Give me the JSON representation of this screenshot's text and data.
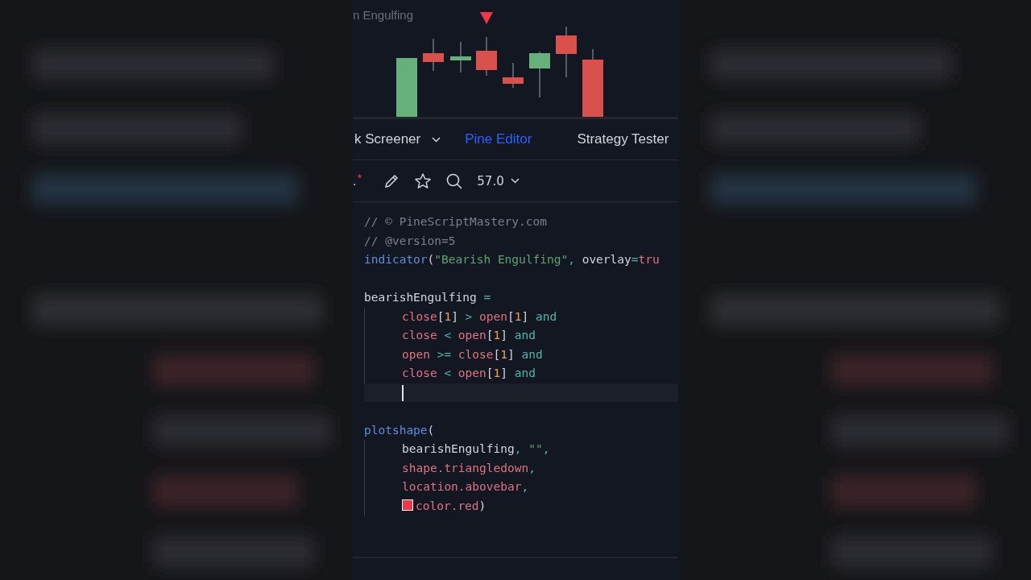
{
  "chart": {
    "title": "n Engulfing"
  },
  "tabs": [
    {
      "label": "k Screener",
      "selected": false,
      "dropdown": true
    },
    {
      "label": "Pine Editor",
      "selected": true,
      "dropdown": false
    },
    {
      "label": "Strategy Tester",
      "selected": false,
      "dropdown": false
    }
  ],
  "toolbar": {
    "script_name": ".",
    "unsaved_mark": "*",
    "version": "57.0"
  },
  "code": [
    {
      "kind": "code",
      "tokens": [
        {
          "kind": "comment",
          "text": "// © PineScriptMastery.com"
        }
      ]
    },
    {
      "kind": "code",
      "tokens": [
        {
          "kind": "comment",
          "text": "// @version=5"
        }
      ]
    },
    {
      "kind": "code",
      "tokens": [
        {
          "kind": "func",
          "text": "indicator"
        },
        {
          "kind": "plain",
          "text": "("
        },
        {
          "kind": "string",
          "text": "\"Bearish Engulfing\""
        },
        {
          "kind": "keyword",
          "text": ","
        },
        {
          "kind": "plain",
          "text": " overlay"
        },
        {
          "kind": "keyword",
          "text": "="
        },
        {
          "kind": "var",
          "text": "tru"
        }
      ]
    },
    {
      "kind": "blank"
    },
    {
      "kind": "code",
      "tokens": [
        {
          "kind": "plain",
          "text": "bearishEngulfing"
        },
        {
          "kind": "keyword",
          "text": " ="
        }
      ],
      "children": [
        {
          "kind": "code",
          "tokens": [
            {
              "kind": "var",
              "text": "close"
            },
            {
              "kind": "plain",
              "text": "["
            },
            {
              "kind": "number",
              "text": "1"
            },
            {
              "kind": "plain",
              "text": "]"
            },
            {
              "kind": "keyword",
              "text": " > "
            },
            {
              "kind": "var",
              "text": "open"
            },
            {
              "kind": "plain",
              "text": "["
            },
            {
              "kind": "number",
              "text": "1"
            },
            {
              "kind": "plain",
              "text": "]"
            },
            {
              "kind": "keyword",
              "text": " and"
            }
          ]
        },
        {
          "kind": "code",
          "tokens": [
            {
              "kind": "var",
              "text": "close"
            },
            {
              "kind": "keyword",
              "text": " < "
            },
            {
              "kind": "var",
              "text": "open"
            },
            {
              "kind": "plain",
              "text": "["
            },
            {
              "kind": "number",
              "text": "1"
            },
            {
              "kind": "plain",
              "text": "]"
            },
            {
              "kind": "keyword",
              "text": " and"
            }
          ]
        },
        {
          "kind": "code",
          "tokens": [
            {
              "kind": "var",
              "text": "open"
            },
            {
              "kind": "keyword",
              "text": " >= "
            },
            {
              "kind": "var",
              "text": "close"
            },
            {
              "kind": "plain",
              "text": "["
            },
            {
              "kind": "number",
              "text": "1"
            },
            {
              "kind": "plain",
              "text": "]"
            },
            {
              "kind": "keyword",
              "text": " and"
            }
          ]
        },
        {
          "kind": "code",
          "tokens": [
            {
              "kind": "var",
              "text": "close"
            },
            {
              "kind": "keyword",
              "text": " < "
            },
            {
              "kind": "var",
              "text": "open"
            },
            {
              "kind": "plain",
              "text": "["
            },
            {
              "kind": "number",
              "text": "1"
            },
            {
              "kind": "plain",
              "text": "]"
            },
            {
              "kind": "keyword",
              "text": " and"
            }
          ]
        },
        {
          "kind": "cursor"
        }
      ]
    },
    {
      "kind": "blank"
    },
    {
      "kind": "code",
      "tokens": [
        {
          "kind": "func",
          "text": "plotshape"
        },
        {
          "kind": "plain",
          "text": "("
        }
      ],
      "children": [
        {
          "kind": "code",
          "tokens": [
            {
              "kind": "plain",
              "text": "bearishEngulfing"
            },
            {
              "kind": "keyword",
              "text": ", "
            },
            {
              "kind": "string",
              "text": "\"\""
            },
            {
              "kind": "keyword",
              "text": ","
            }
          ]
        },
        {
          "kind": "code",
          "tokens": [
            {
              "kind": "var",
              "text": "shape.triangledown"
            },
            {
              "kind": "keyword",
              "text": ","
            }
          ]
        },
        {
          "kind": "code",
          "tokens": [
            {
              "kind": "var",
              "text": "location.abovebar"
            },
            {
              "kind": "keyword",
              "text": ","
            }
          ]
        },
        {
          "kind": "code",
          "tokens": [
            {
              "kind": "swatch",
              "color": "#f23645"
            },
            {
              "kind": "var",
              "text": "color.red"
            },
            {
              "kind": "plain",
              "text": ")"
            }
          ]
        }
      ]
    }
  ]
}
